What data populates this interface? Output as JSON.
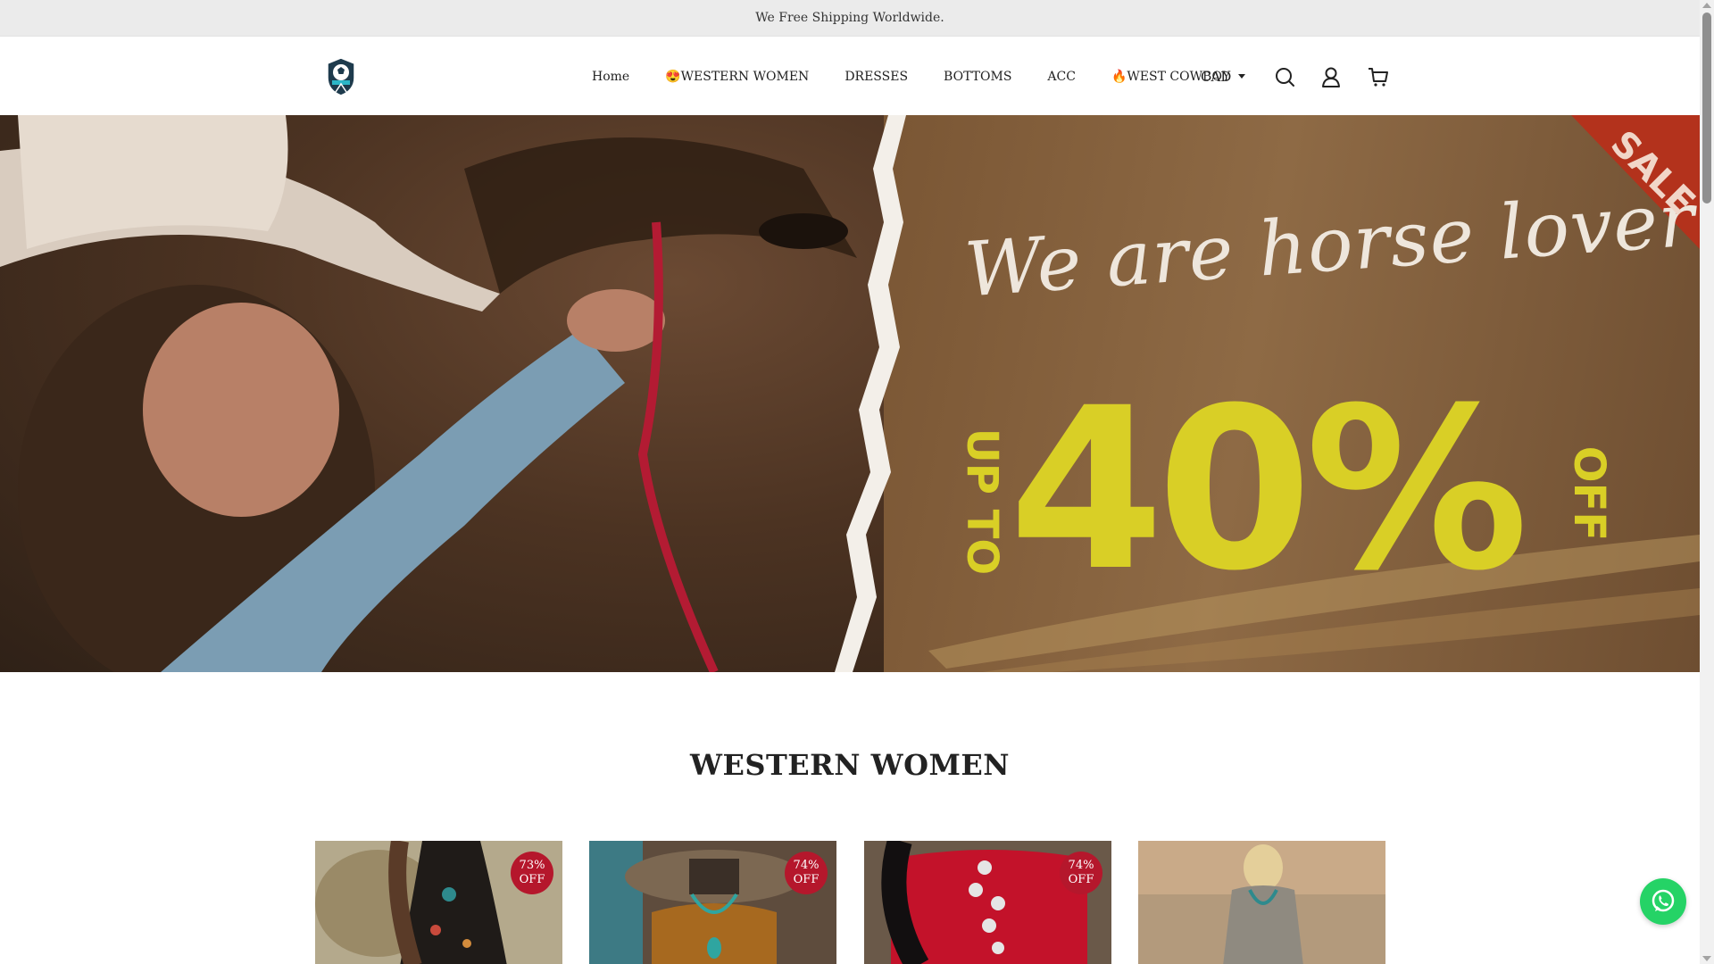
{
  "announcement": "We Free Shipping Worldwide.",
  "nav": {
    "items": [
      {
        "label": "Home"
      },
      {
        "label": "😍WESTERN WOMEN"
      },
      {
        "label": "DRESSES"
      },
      {
        "label": "BOTTOMS"
      },
      {
        "label": "ACC"
      },
      {
        "label": "🔥WEST COWBOY"
      }
    ],
    "currency": "CAD",
    "icons": [
      "search-icon",
      "account-icon",
      "cart-icon"
    ]
  },
  "hero": {
    "script_text": "We are horse lover",
    "up_to": "UP TO",
    "percent": "40%",
    "off": "OFF",
    "sale": "SALE",
    "colors": {
      "yellow": "#d9cf26",
      "sale_red": "#b3321c"
    }
  },
  "section": {
    "title": "WESTERN WOMEN",
    "products": [
      {
        "badge": "73% OFF",
        "accent": "#1f1b18"
      },
      {
        "badge": "74% OFF",
        "accent": "#a7691f"
      },
      {
        "badge": "74% OFF",
        "accent": "#c3122a"
      },
      {
        "badge": "",
        "accent": "#b39a7c"
      }
    ]
  },
  "colors": {
    "badge": "#b5172c",
    "whatsapp": "#25d366",
    "announce_bg": "#ebebeb"
  }
}
